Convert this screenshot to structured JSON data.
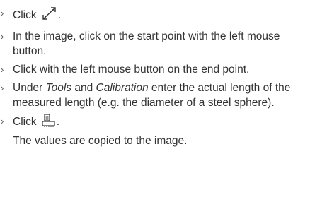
{
  "steps": [
    {
      "text": "Click",
      "icon": "measure-line-icon",
      "suffix": "."
    },
    {
      "text": "In the image, click on the start point with the left mouse button."
    },
    {
      "text": "Click with the left mouse button on the end point."
    },
    {
      "prefix": "Under ",
      "em1": "Tools",
      "mid": " and ",
      "em2": "Calibration",
      "suffix": " enter the actual length of the measured length (e.g. the diameter of a steel sphere)."
    },
    {
      "text": "Click",
      "icon": "copy-values-icon",
      "suffix": "."
    }
  ],
  "result": "The values are copied to the image.",
  "bullet_glyph": "›"
}
